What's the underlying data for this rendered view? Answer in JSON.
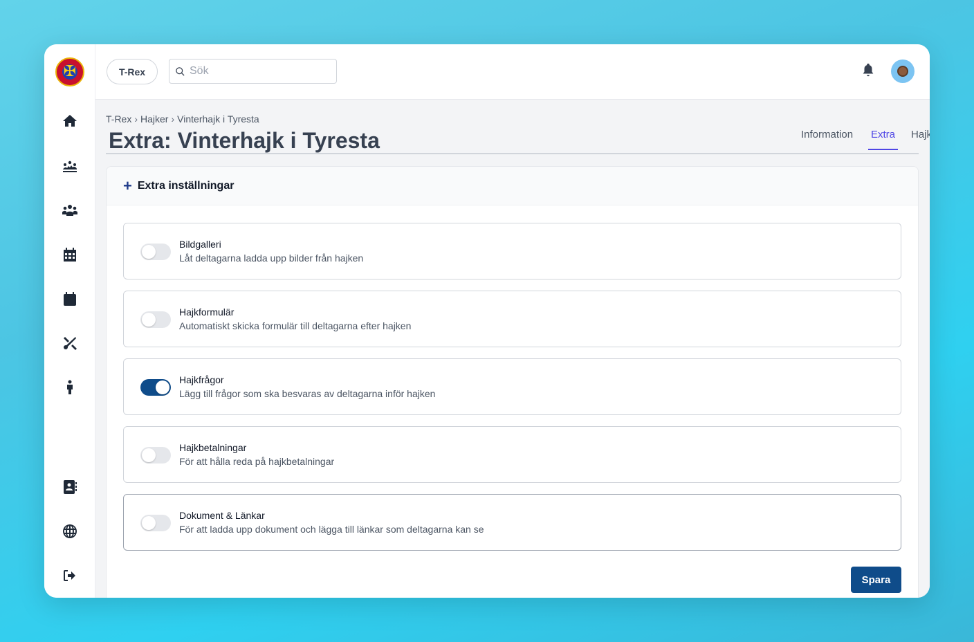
{
  "topbar": {
    "context_pill": "T-Rex",
    "search_placeholder": "Sök",
    "search_value": ""
  },
  "sidebar": {
    "logo_icon": "scout-emblem-logo",
    "items": [
      {
        "name": "home",
        "icon": "home-icon"
      },
      {
        "name": "hajker",
        "icon": "campfire-group-icon"
      },
      {
        "name": "members",
        "icon": "users-icon"
      },
      {
        "name": "schedule",
        "icon": "calendar-grid-icon"
      },
      {
        "name": "calendar",
        "icon": "calendar-icon"
      },
      {
        "name": "tools",
        "icon": "tools-icon"
      },
      {
        "name": "person",
        "icon": "person-icon"
      },
      {
        "name": "contacts",
        "icon": "address-book-icon"
      },
      {
        "name": "web",
        "icon": "globe-icon"
      },
      {
        "name": "logout",
        "icon": "logout-icon"
      }
    ]
  },
  "breadcrumb": [
    "T-Rex",
    "Hajker",
    "Vinterhajk i Tyresta"
  ],
  "page_title": "Extra: Vinterhajk i Tyresta",
  "tabs": [
    {
      "label": "Information",
      "active": false
    },
    {
      "label": "Extra",
      "active": true
    },
    {
      "label": "Hajkfrågor",
      "active": false
    }
  ],
  "card": {
    "title": "Extra inställningar",
    "options": [
      {
        "title": "Bildgalleri",
        "description": "Låt deltagarna ladda upp bilder från hajken",
        "enabled": false
      },
      {
        "title": "Hajkformulär",
        "description": "Automatiskt skicka formulär till deltagarna efter hajken",
        "enabled": false
      },
      {
        "title": "Hajkfrågor",
        "description": "Lägg till frågor som ska besvaras av deltagarna inför hajken",
        "enabled": true
      },
      {
        "title": "Hajkbetalningar",
        "description": "För att hålla reda på hajkbetalningar",
        "enabled": false
      },
      {
        "title": "Dokument & Länkar",
        "description": "För att ladda upp dokument och lägga till länkar som deltagarna kan se",
        "enabled": false
      }
    ],
    "save_label": "Spara"
  },
  "colors": {
    "primary": "#0f4c8a",
    "active_tab": "#4f46e5",
    "toggle_off": "#e5e7eb"
  }
}
